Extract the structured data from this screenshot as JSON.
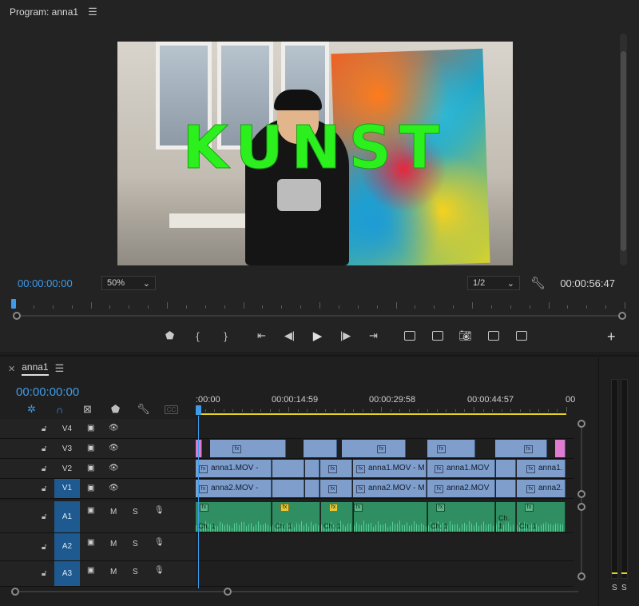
{
  "program_monitor": {
    "title": "Program: anna1",
    "video_overlay_text": "KUNST",
    "current_timecode": "00:00:00:00",
    "duration_timecode": "00:00:56:47",
    "zoom_level": "50%",
    "resolution": "1/2"
  },
  "timeline": {
    "sequence_name": "anna1",
    "current_timecode": "00:00:00:00",
    "ruler_labels": [
      ":00:00",
      "00:00:14:59",
      "00:00:29:58",
      "00:00:44:57",
      "00"
    ],
    "video_tracks": [
      {
        "name": "V4",
        "clips": []
      },
      {
        "name": "V3",
        "clips": [
          {
            "label": "",
            "fx": true,
            "kind": "pink"
          },
          {
            "label": "",
            "fx": true
          }
        ]
      },
      {
        "name": "V2",
        "clips": [
          {
            "label": "anna1.MOV -",
            "fx": true
          },
          {
            "label": "anna1.MOV - M",
            "fx": true
          },
          {
            "label": "anna1.MOV",
            "fx": true
          },
          {
            "label": "anna1.",
            "fx": true
          }
        ]
      },
      {
        "name": "V1",
        "clips": [
          {
            "label": "anna2.MOV -",
            "fx": true
          },
          {
            "label": "anna2.MOV - M",
            "fx": true
          },
          {
            "label": "anna2.MOV",
            "fx": true
          },
          {
            "label": "anna2.",
            "fx": true
          }
        ]
      }
    ],
    "audio_tracks": [
      {
        "name": "A1",
        "mute": "M",
        "solo": "S",
        "channel_label": "Ch. 1"
      },
      {
        "name": "A2",
        "mute": "M",
        "solo": "S"
      },
      {
        "name": "A3",
        "mute": "M",
        "solo": "S"
      }
    ]
  },
  "audio_meter": {
    "solo_left": "S",
    "solo_right": "S"
  },
  "colors": {
    "accent_blue": "#3e9be9",
    "video_clip": "#7f9ecc",
    "audio_clip": "#2f8f63",
    "work_area": "#e5d41e",
    "overlay_green": "#2cf01e"
  },
  "icons": [
    "hamburger-icon",
    "wrench-icon",
    "marker-icon",
    "mark-in-icon",
    "mark-out-icon",
    "go-to-in-icon",
    "step-back-icon",
    "play-icon",
    "step-forward-icon",
    "go-to-out-icon",
    "lift-icon",
    "extract-icon",
    "camera-icon",
    "compare-icon",
    "multicam-icon",
    "add-icon",
    "snap-icon",
    "linked-selection-icon",
    "lock-icon",
    "eye-icon",
    "mic-icon",
    "close-icon"
  ]
}
